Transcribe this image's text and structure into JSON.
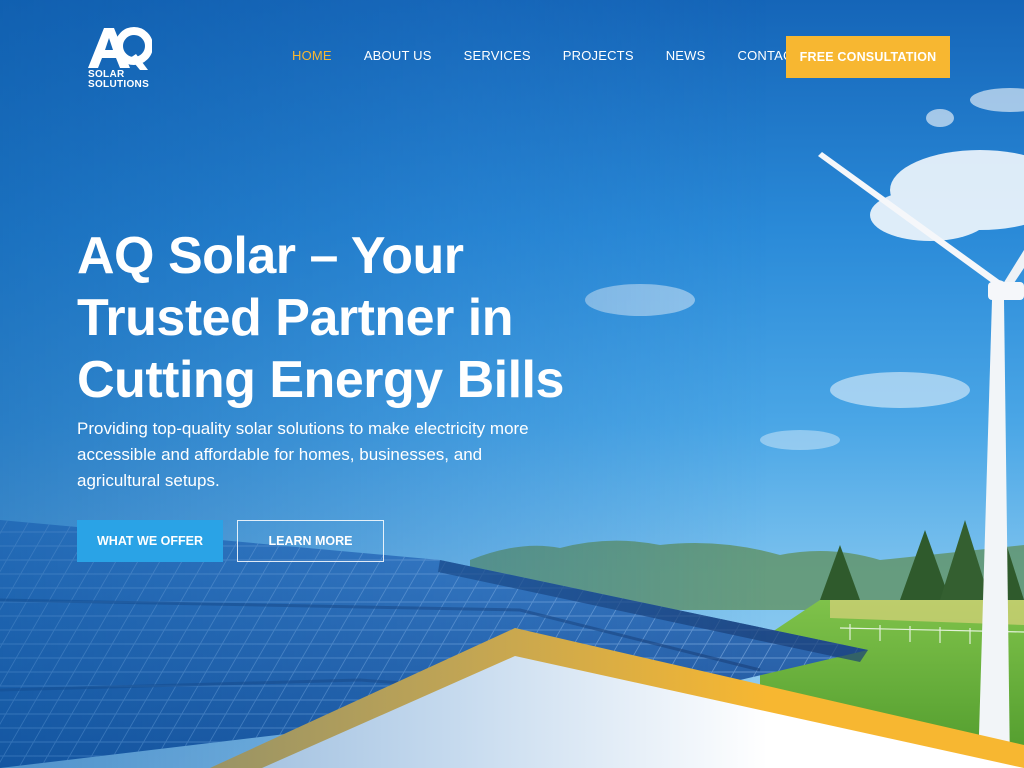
{
  "brand": {
    "logo_letters": "AQ",
    "logo_line1": "SOLAR",
    "logo_line2": "SOLUTIONS"
  },
  "nav": {
    "items": [
      {
        "label": "HOME",
        "active": true
      },
      {
        "label": "ABOUT US",
        "active": false
      },
      {
        "label": "SERVICES",
        "active": false
      },
      {
        "label": "PROJECTS",
        "active": false
      },
      {
        "label": "NEWS",
        "active": false
      },
      {
        "label": "CONTACT",
        "active": false
      }
    ],
    "cta_label": "FREE CONSULTATION"
  },
  "hero": {
    "title_line1": "AQ Solar – Your",
    "title_line2": "Trusted Partner in",
    "title_line3": "Cutting Energy Bills",
    "subtitle": "Providing top-quality solar solutions to make electricity more accessible and affordable for homes, businesses, and agricultural setups.",
    "primary_button": "WHAT WE OFFER",
    "secondary_button": "LEARN MORE"
  },
  "colors": {
    "accent": "#f7b731",
    "primary_button": "#2aa3e6",
    "sky": "#2a8ad8"
  }
}
